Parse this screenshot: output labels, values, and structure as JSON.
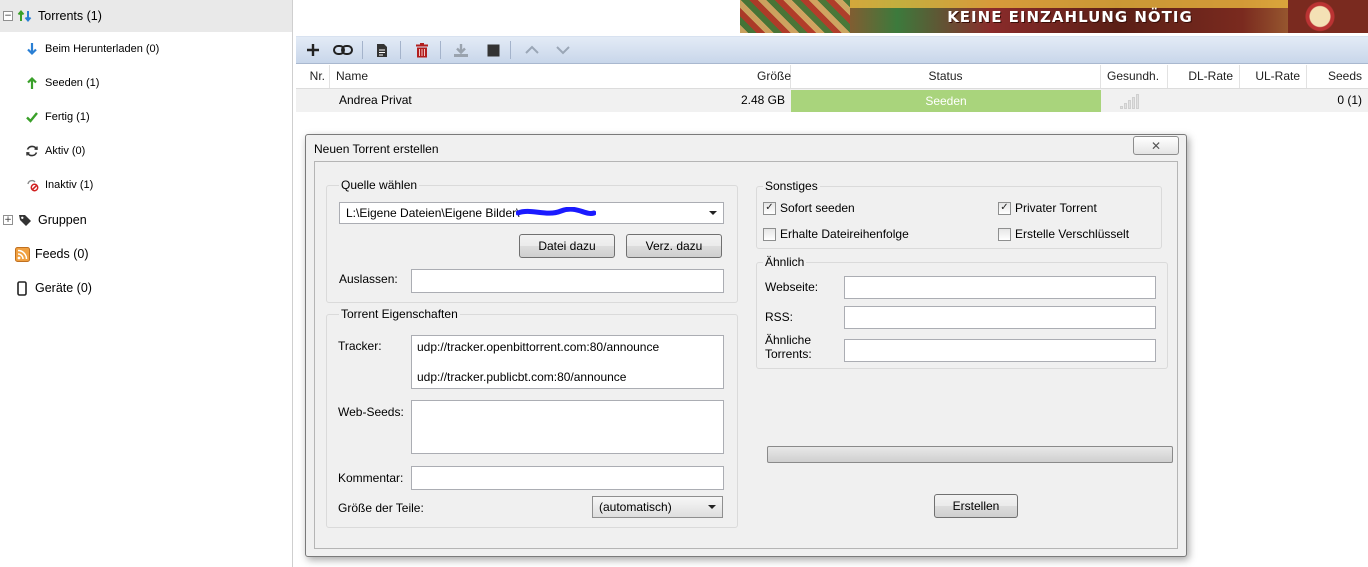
{
  "sidebar": {
    "torrents": "Torrents (1)",
    "downloading": "Beim Herunterladen (0)",
    "seeding": "Seeden (1)",
    "finished": "Fertig (1)",
    "active": "Aktiv (0)",
    "inactive": "Inaktiv (1)",
    "groups": "Gruppen",
    "feeds": "Feeds (0)",
    "devices": "Geräte (0)"
  },
  "ad": {
    "text": "KEINE EINZAHLUNG NÖTIG"
  },
  "table": {
    "headers": {
      "nr": "Nr.",
      "name": "Name",
      "size": "Größe",
      "status": "Status",
      "health": "Gesundh.",
      "dl": "DL-Rate",
      "ul": "UL-Rate",
      "seeds": "Seeds"
    },
    "row": {
      "name": "Andrea Privat",
      "size": "2.48 GB",
      "status": "Seeden",
      "seeds": "0 (1)"
    }
  },
  "dialog": {
    "title": "Neuen Torrent erstellen",
    "close_glyph": "✕",
    "source": {
      "legend": "Quelle wählen",
      "path": "L:\\Eigene Dateien\\Eigene Bilder\\",
      "add_file": "Datei dazu",
      "add_dir": "Verz. dazu",
      "skip_label": "Auslassen:",
      "skip_value": ""
    },
    "props": {
      "legend": "Torrent Eigenschaften",
      "tracker_label": "Tracker:",
      "tracker_value": "udp://tracker.openbittorrent.com:80/announce\n\nudp://tracker.publicbt.com:80/announce",
      "webseeds_label": "Web-Seeds:",
      "webseeds_value": "",
      "comment_label": "Kommentar:",
      "comment_value": "",
      "piece_label": "Größe der Teile:",
      "piece_value": "(automatisch)"
    },
    "other": {
      "legend": "Sonstiges",
      "start_seeding": "Sofort seeden",
      "private": "Privater Torrent",
      "preserve_order": "Erhalte Dateireihenfolge",
      "encrypted": "Erstelle Verschlüsselt"
    },
    "similar": {
      "legend": "Ähnlich",
      "website_label": "Webseite:",
      "rss_label": "RSS:",
      "similar_label": "Ähnliche\nTorrents:"
    },
    "create_button": "Erstellen"
  },
  "colors": {
    "seeding_bar": "#a9d47c",
    "toolbar": "#c8d6ea",
    "scribble": "#1a1aff"
  }
}
